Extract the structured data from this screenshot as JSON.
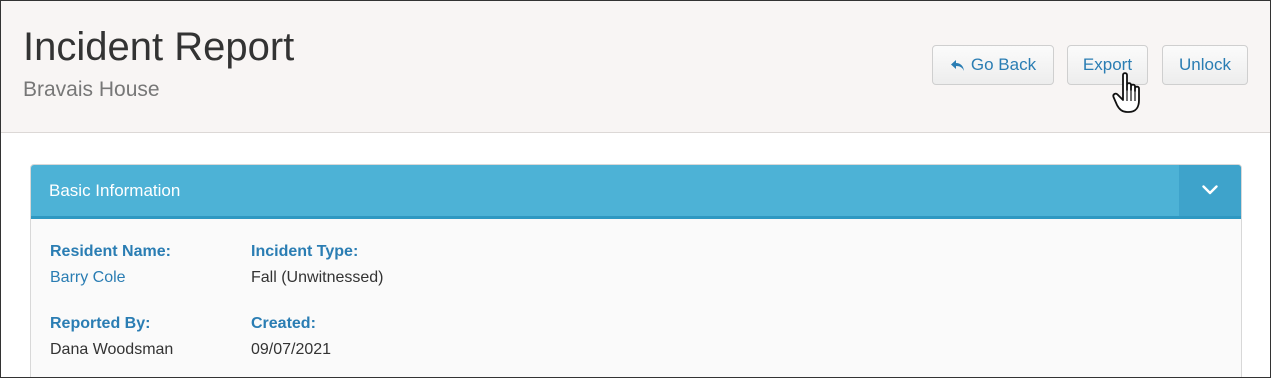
{
  "header": {
    "title": "Incident Report",
    "subtitle": "Bravais House"
  },
  "actions": {
    "go_back": "Go Back",
    "export": "Export",
    "unlock": "Unlock"
  },
  "panel": {
    "title": "Basic Information",
    "fields": [
      {
        "label": "Resident Name:",
        "value": "Barry Cole"
      },
      {
        "label": "Incident Type:",
        "value": "Fall (Unwitnessed)"
      },
      {
        "label": "Reported By:",
        "value": "Dana Woodsman"
      },
      {
        "label": "Created:",
        "value": "09/07/2021"
      }
    ]
  },
  "icons": {
    "back": "reply-arrow-icon",
    "toggle": "chevron-down-icon",
    "cursor": "hand-pointer-icon"
  },
  "colors": {
    "accent": "#2a7db3",
    "panel_header": "#4db2d6",
    "header_bg": "#f8f5f4"
  }
}
